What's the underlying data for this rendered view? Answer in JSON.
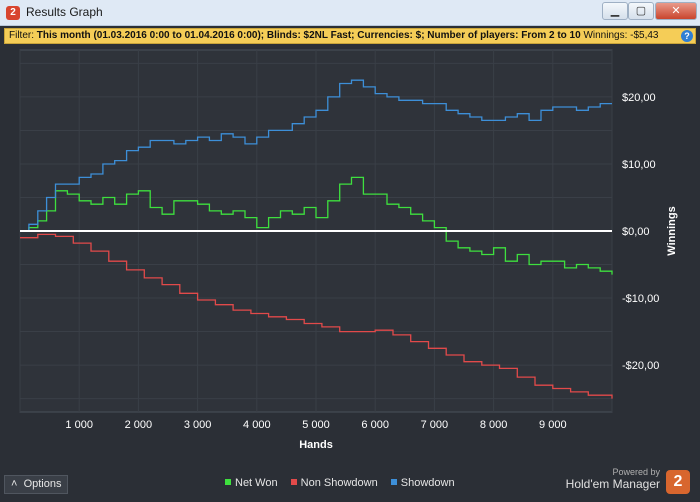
{
  "window": {
    "title": "Results Graph",
    "min_glyph": "▁",
    "max_glyph": "▢",
    "close_glyph": "✕"
  },
  "filter": {
    "label": "Filter:",
    "text": " This month (01.03.2016 0:00 to 01.04.2016 0:00); Blinds: $2NL Fast; Currencies: $; Number of players: From 2 to 10",
    "winnings": " Winnings: -$5,43",
    "help_glyph": "?"
  },
  "options": {
    "label": "Options",
    "glyph": "˄"
  },
  "brand": {
    "powered_by": "Powered by",
    "name": "Hold'em Manager",
    "logo": "2"
  },
  "colors": {
    "net_won": "#3ee03e",
    "non_showdown": "#e24a4a",
    "showdown": "#3d8fd8",
    "zero_line": "#ffffff",
    "grid": "#3a3f47"
  },
  "chart_data": {
    "type": "line",
    "xlabel": "Hands",
    "ylabel": "Winnings",
    "xlim": [
      0,
      10000
    ],
    "ylim": [
      -27,
      27
    ],
    "x_ticks": [
      1000,
      2000,
      3000,
      4000,
      5000,
      6000,
      7000,
      8000,
      9000
    ],
    "x_tick_labels": [
      "1 000",
      "2 000",
      "3 000",
      "4 000",
      "5 000",
      "6 000",
      "7 000",
      "8 000",
      "9 000"
    ],
    "y_ticks": [
      20,
      10,
      0,
      -10,
      -20
    ],
    "y_tick_labels": [
      "$20,00",
      "$10,00",
      "$0,00",
      "-$10,00",
      "-$20,00"
    ],
    "grid": true,
    "legend_position": "bottom-center",
    "series": [
      {
        "name": "Net Won",
        "x": [
          0,
          150,
          300,
          450,
          600,
          800,
          1000,
          1200,
          1400,
          1600,
          1800,
          2000,
          2200,
          2400,
          2600,
          2800,
          3000,
          3200,
          3400,
          3600,
          3800,
          4000,
          4200,
          4400,
          4600,
          4800,
          5000,
          5200,
          5400,
          5600,
          5800,
          6000,
          6200,
          6400,
          6600,
          6800,
          7000,
          7200,
          7400,
          7600,
          7800,
          8000,
          8200,
          8400,
          8600,
          8800,
          9000,
          9200,
          9400,
          9600,
          9800,
          10000
        ],
        "y": [
          0,
          0.5,
          1.5,
          3,
          6,
          5.5,
          4.5,
          4,
          5,
          4,
          5.5,
          6,
          3.5,
          2.5,
          4.5,
          4.5,
          4,
          3,
          2.5,
          3,
          2,
          0.5,
          2,
          3,
          2.5,
          3.5,
          2,
          4.5,
          7,
          8,
          5.5,
          5.5,
          4,
          3.5,
          2.5,
          1.5,
          0.5,
          -1.5,
          -2.5,
          -3,
          -3.5,
          -2.5,
          -4.5,
          -3.5,
          -5,
          -4.5,
          -4.5,
          -5.5,
          -5,
          -5.5,
          -6,
          -6.5
        ]
      },
      {
        "name": "Non Showdown",
        "x": [
          0,
          300,
          600,
          900,
          1200,
          1500,
          1800,
          2100,
          2400,
          2700,
          3000,
          3300,
          3600,
          3900,
          4200,
          4500,
          4800,
          5100,
          5400,
          5700,
          6000,
          6300,
          6600,
          6900,
          7200,
          7500,
          7800,
          8100,
          8400,
          8700,
          9000,
          9300,
          9600,
          10000
        ],
        "y": [
          -1,
          -0.5,
          -0.8,
          -1.8,
          -3,
          -4.5,
          -5.8,
          -7,
          -8,
          -9.3,
          -10.3,
          -11,
          -11.8,
          -12.3,
          -12.8,
          -13.2,
          -13.8,
          -14.3,
          -15,
          -15,
          -14.8,
          -15.5,
          -16.5,
          -17.5,
          -18.5,
          -19.5,
          -20,
          -20.5,
          -21.8,
          -23,
          -23.5,
          -24,
          -24.5,
          -25
        ]
      },
      {
        "name": "Showdown",
        "x": [
          0,
          150,
          300,
          450,
          600,
          800,
          1000,
          1200,
          1400,
          1600,
          1800,
          2000,
          2200,
          2400,
          2600,
          2800,
          3000,
          3200,
          3400,
          3600,
          3800,
          4000,
          4200,
          4400,
          4600,
          4800,
          5000,
          5200,
          5400,
          5600,
          5800,
          6000,
          6200,
          6400,
          6600,
          6800,
          7000,
          7200,
          7400,
          7600,
          7800,
          8000,
          8200,
          8400,
          8600,
          8800,
          9000,
          9200,
          9400,
          9600,
          9800,
          10000
        ],
        "y": [
          0,
          1,
          3,
          5,
          7,
          7,
          8,
          8.5,
          10,
          10.5,
          12,
          12.5,
          13.5,
          13.5,
          13,
          13.5,
          14,
          13.5,
          14.5,
          14,
          13,
          14,
          15,
          15,
          16,
          17,
          18,
          20,
          22,
          22.5,
          21.5,
          20.5,
          20,
          19.5,
          19.5,
          19,
          19,
          18,
          17.5,
          17,
          16.5,
          16.5,
          17,
          17.5,
          16.5,
          18,
          18.5,
          18.5,
          18,
          18.5,
          19,
          19
        ]
      }
    ]
  }
}
